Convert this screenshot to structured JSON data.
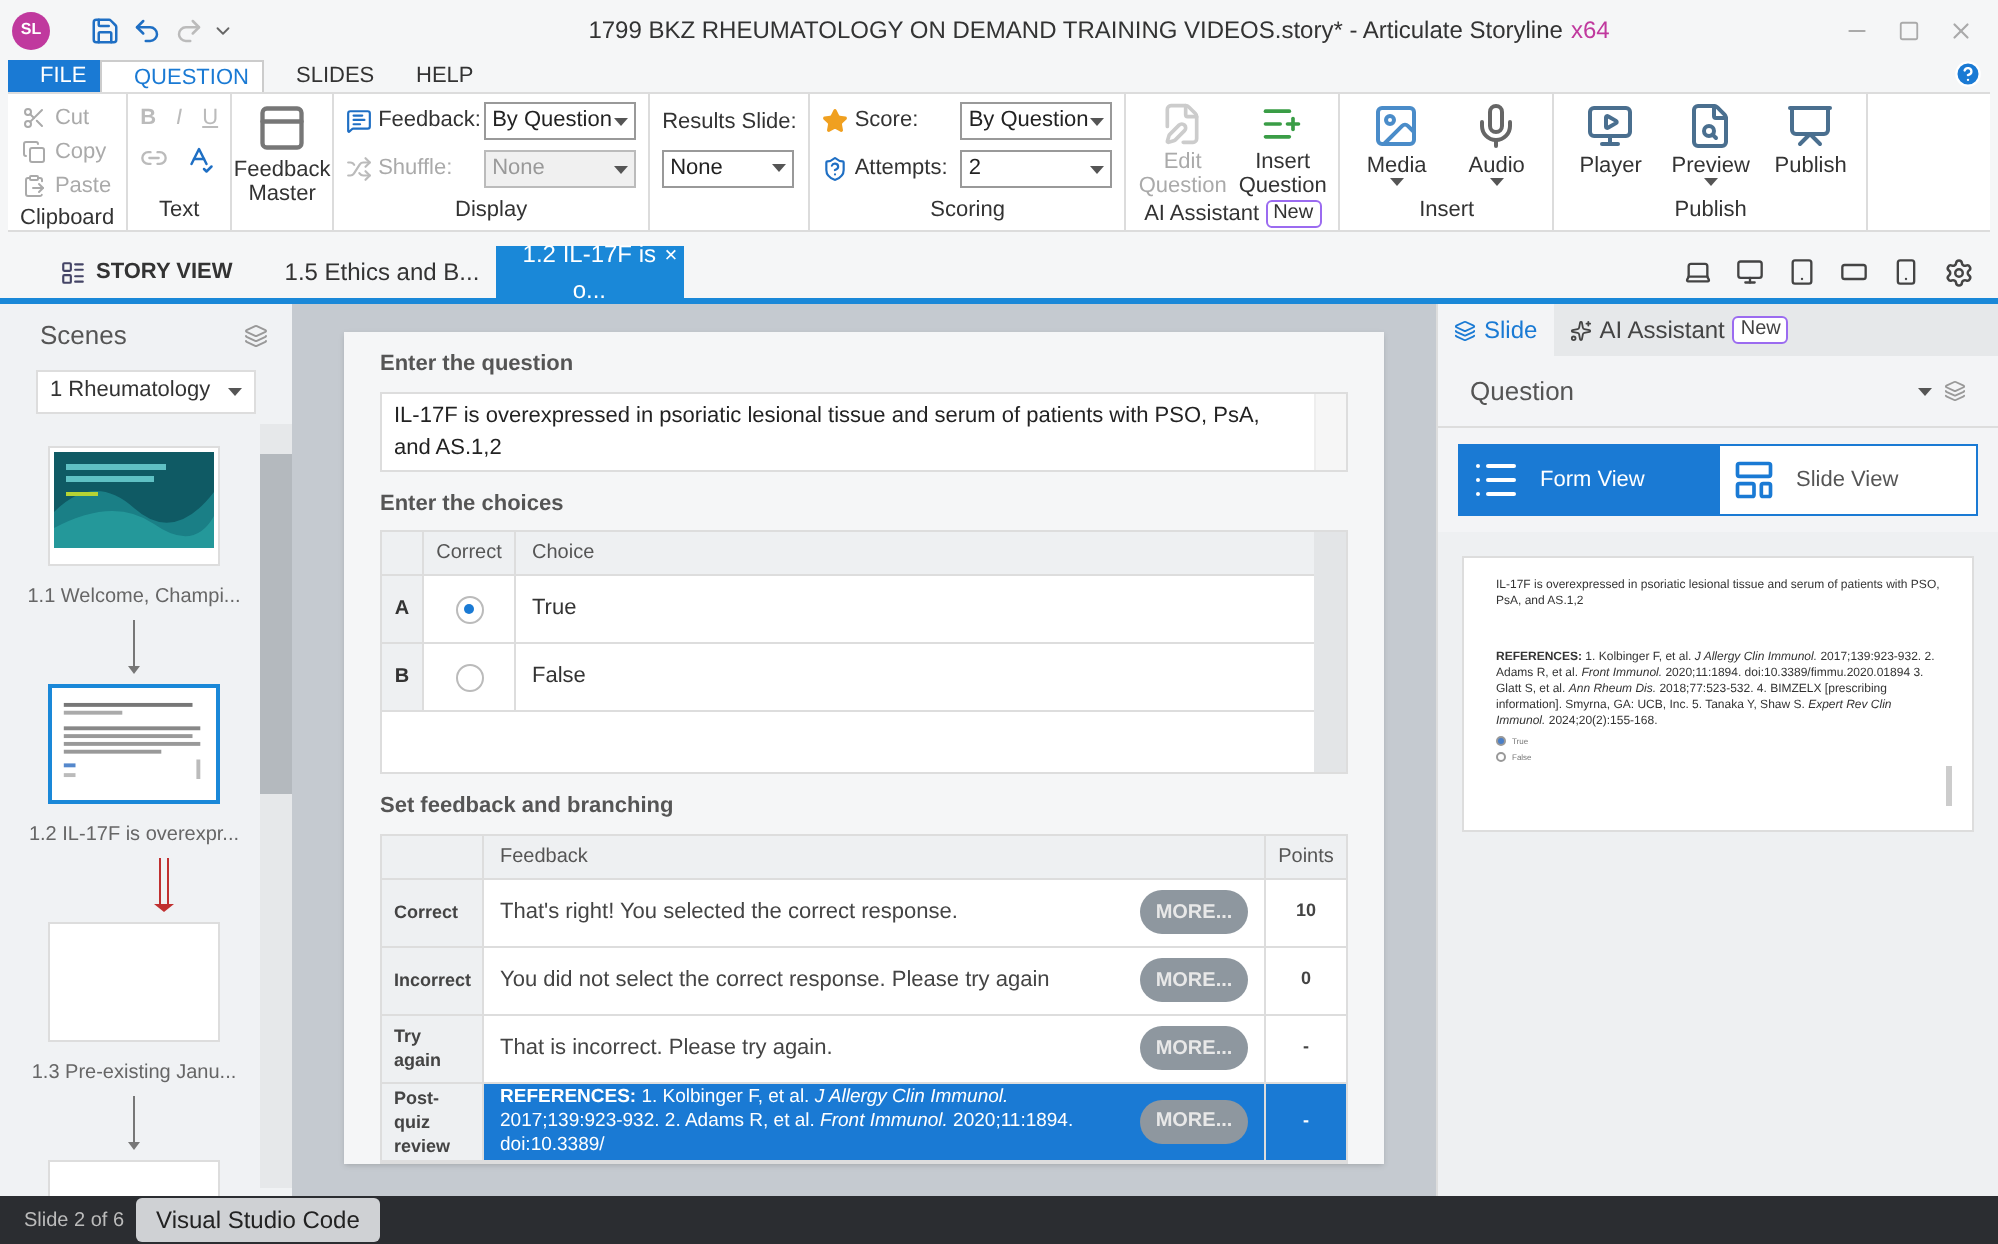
{
  "window": {
    "app_badge": "SL",
    "title": "1799 BKZ RHEUMATOLOGY ON DEMAND TRAINING VIDEOS.story* - Articulate Storyline",
    "edition": "x64"
  },
  "ribbon_tabs": [
    {
      "label": "FILE",
      "kind": "file",
      "selected": false
    },
    {
      "label": "QUESTION",
      "kind": "tab",
      "selected": true
    },
    {
      "label": "SLIDES",
      "kind": "tab",
      "selected": false
    },
    {
      "label": "HELP",
      "kind": "tab",
      "selected": false
    }
  ],
  "ribbon": {
    "clipboard": {
      "label": "Clipboard",
      "disabled": true,
      "items": [
        {
          "label": "Cut"
        },
        {
          "label": "Copy"
        },
        {
          "label": "Paste"
        }
      ]
    },
    "text": {
      "label": "Text",
      "disabled": true,
      "styles": [
        "B",
        "I",
        "U"
      ]
    },
    "feedback_master": {
      "label": "Feedback Master"
    },
    "display": {
      "label": "Display",
      "feedback": {
        "label": "Feedback:",
        "value": "By Question",
        "disabled": false
      },
      "shuffle": {
        "label": "Shuffle:",
        "value": "None",
        "disabled": true
      }
    },
    "results_slide": {
      "label": "Results Slide:",
      "value": "None"
    },
    "scoring": {
      "label": "Scoring",
      "score": {
        "label": "Score:",
        "value": "By Question"
      },
      "attempts": {
        "label": "Attempts:",
        "value": "2"
      }
    },
    "ai_assistant": {
      "label": "AI Assistant",
      "badge": "New",
      "buttons": [
        {
          "label": "Edit Question",
          "disabled": true
        },
        {
          "label": "Insert Question",
          "disabled": false
        }
      ]
    },
    "insert": {
      "label": "Insert",
      "buttons": [
        {
          "label": "Media",
          "menu": true
        },
        {
          "label": "Audio",
          "menu": true
        }
      ]
    },
    "publish": {
      "label": "Publish",
      "buttons": [
        {
          "label": "Player",
          "menu": false
        },
        {
          "label": "Preview",
          "menu": true
        },
        {
          "label": "Publish",
          "menu": false
        }
      ]
    }
  },
  "doc_tabs": [
    {
      "label": "STORY VIEW",
      "kind": "story",
      "selected": false
    },
    {
      "label": "1.5 Ethics and B...",
      "kind": "slide",
      "selected": false
    },
    {
      "label": "1.2 IL-17F is o...",
      "kind": "slide",
      "selected": true,
      "close": "×"
    }
  ],
  "scenes": {
    "title": "Scenes",
    "scene": "1 Rheumatology",
    "slides": [
      {
        "label": "1.1 Welcome, Champi...",
        "kind": "picture",
        "selected": false,
        "branch": false
      },
      {
        "label": "1.2 IL-17F is overexpr...",
        "kind": "text",
        "selected": true,
        "branch": true
      },
      {
        "label": "1.3 Pre-existing Janu...",
        "kind": "blank",
        "selected": false,
        "branch": false
      },
      {
        "kind": "blank",
        "selected": false
      }
    ]
  },
  "form": {
    "question": {
      "heading": "Enter the question",
      "text": "IL-17F is overexpressed in psoriatic lesional tissue and serum of patients with PSO, PsA, and AS.1,2"
    },
    "choices": {
      "heading": "Enter the choices",
      "columns": [
        "Correct",
        "Choice"
      ],
      "rows": [
        {
          "letter": "A",
          "text": "True",
          "selected": true
        },
        {
          "letter": "B",
          "text": "False",
          "selected": false
        }
      ]
    },
    "feedback": {
      "heading": "Set feedback and branching",
      "columns": [
        "Feedback",
        "Points"
      ],
      "rows": [
        {
          "label": "Correct",
          "text": "That's right! You selected the correct response.",
          "button": "MORE...",
          "points": "10",
          "selected": false
        },
        {
          "label": "Incorrect",
          "text": "You did not select the correct response. Please try again",
          "button": "MORE...",
          "points": "0",
          "selected": false
        },
        {
          "label": "Try again",
          "text": "That is incorrect. Please try again.",
          "button": "MORE...",
          "points": "-",
          "selected": false
        },
        {
          "label": "Post-quiz review",
          "text": "**REFERENCES:** 1. Kolbinger F, et al. *J Allergy Clin Immunol.* 2017;139:923-932. 2. Adams R, et al. *Front Immunol.* 2020;11:1894. doi:10.3389/",
          "button": "MORE...",
          "points": "-",
          "selected": true
        }
      ]
    }
  },
  "right_panel": {
    "tabs": [
      {
        "label": "Slide",
        "selected": true
      },
      {
        "label": "AI Assistant",
        "badge": "New",
        "selected": false
      }
    ],
    "title": "Question",
    "views": [
      {
        "label": "Form View",
        "selected": true
      },
      {
        "label": "Slide View",
        "selected": false
      }
    ],
    "preview": {
      "question": "IL-17F is overexpressed in psoriatic lesional tissue and serum of patients with PSO, PsA, and AS.1,2",
      "references": "**REFERENCES:** 1. Kolbinger F, et al. *J Allergy Clin Immunol.* 2017;139:923-932. 2. Adams R, et al. *Front Immunol.* 2020;11:1894. doi:10.3389/fimmu.2020.01894 3. Glatt S, et al. *Ann Rheum Dis.* 2018;77:523-532. 4. BIMZELX [prescribing information]. Smyrna, GA: UCB, Inc. 5. Tanaka Y, Shaw S. *Expert Rev Clin Immunol.* 2024;20(2):155-168.",
      "choices": [
        {
          "label": "True",
          "selected": true
        },
        {
          "label": "False",
          "selected": false
        }
      ]
    }
  },
  "status_bar": {
    "slide": "Slide 2 of 6",
    "tooltip": "Visual Studio Code"
  }
}
